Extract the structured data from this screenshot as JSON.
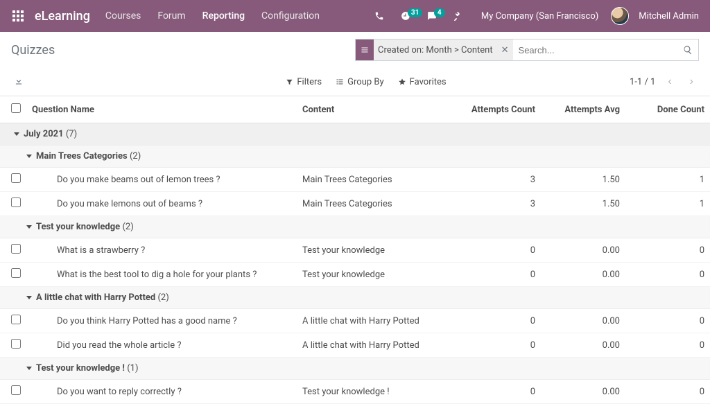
{
  "brand": "eLearning",
  "nav": {
    "courses": "Courses",
    "forum": "Forum",
    "reporting": "Reporting",
    "configuration": "Configuration"
  },
  "badges": {
    "calendar": "31",
    "chat": "4"
  },
  "company": "My Company (San Francisco)",
  "user": "Mitchell Admin",
  "breadcrumb": "Quizzes",
  "search": {
    "facet": "Created on: Month > Content",
    "placeholder": "Search..."
  },
  "filter_menu": {
    "filters": "Filters",
    "groupby": "Group By",
    "favorites": "Favorites"
  },
  "pager": "1-1 / 1",
  "columns": {
    "question": "Question Name",
    "content": "Content",
    "attempts_count": "Attempts Count",
    "attempts_avg": "Attempts Avg",
    "done_count": "Done Count"
  },
  "groups": [
    {
      "label": "July 2021",
      "count": "(7)",
      "level": 0,
      "subgroups": [
        {
          "label": "Main Trees Categories",
          "count": "(2)",
          "level": 1,
          "rows": [
            {
              "q": "Do you make beams out of lemon trees ?",
              "c": "Main Trees Categories",
              "ac": "3",
              "aa": "1.50",
              "dc": "1"
            },
            {
              "q": "Do you make lemons out of beams ?",
              "c": "Main Trees Categories",
              "ac": "3",
              "aa": "1.50",
              "dc": "1"
            }
          ]
        },
        {
          "label": "Test your knowledge",
          "count": "(2)",
          "level": 1,
          "rows": [
            {
              "q": "What is a strawberry ?",
              "c": "Test your knowledge",
              "ac": "0",
              "aa": "0.00",
              "dc": "0"
            },
            {
              "q": "What is the best tool to dig a hole for your plants ?",
              "c": "Test your knowledge",
              "ac": "0",
              "aa": "0.00",
              "dc": "0"
            }
          ]
        },
        {
          "label": "A little chat with Harry Potted",
          "count": "(2)",
          "level": 1,
          "rows": [
            {
              "q": "Do you think Harry Potted has a good name ?",
              "c": "A little chat with Harry Potted",
              "ac": "0",
              "aa": "0.00",
              "dc": "0"
            },
            {
              "q": "Did you read the whole article ?",
              "c": "A little chat with Harry Potted",
              "ac": "0",
              "aa": "0.00",
              "dc": "0"
            }
          ]
        },
        {
          "label": "Test your knowledge !",
          "count": "(1)",
          "level": 1,
          "rows": [
            {
              "q": "Do you want to reply correctly ?",
              "c": "Test your knowledge !",
              "ac": "0",
              "aa": "0.00",
              "dc": "0"
            }
          ]
        }
      ]
    }
  ]
}
